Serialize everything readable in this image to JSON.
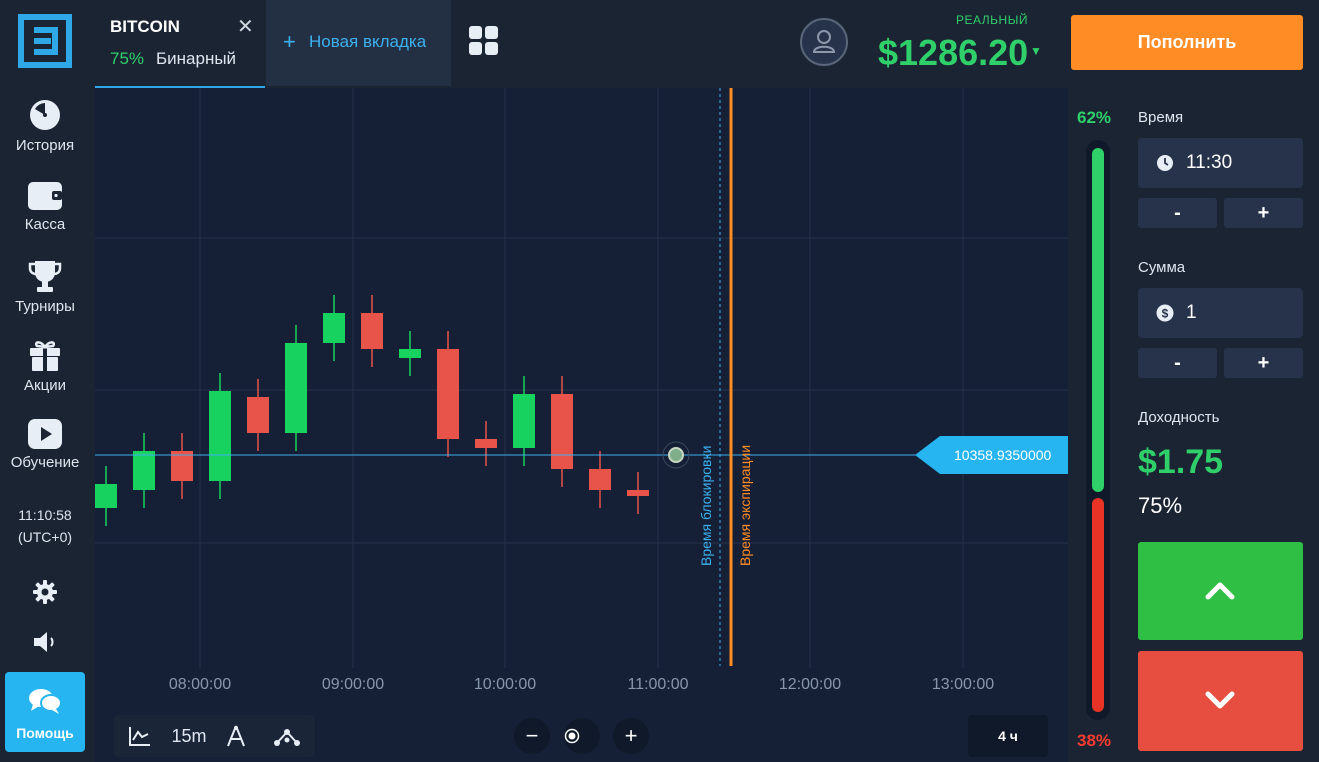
{
  "sidebar": {
    "items": [
      {
        "label": "История",
        "icon": "history-clock-icon"
      },
      {
        "label": "Касса",
        "icon": "wallet-icon"
      },
      {
        "label": "Турниры",
        "icon": "trophy-icon"
      },
      {
        "label": "Акции",
        "icon": "gift-icon"
      },
      {
        "label": "Обучение",
        "icon": "play-icon"
      }
    ],
    "clock_time": "11:10:58",
    "clock_tz": "(UTC+0)",
    "help_label": "Помощь"
  },
  "tabs": {
    "active": {
      "title": "BITCOIN",
      "percent": "75%",
      "type": "Бинарный"
    },
    "new_tab_label": "Новая вкладка"
  },
  "account": {
    "type_label": "РЕАЛЬНЫЙ",
    "balance": "$1286.20",
    "deposit_label": "Пополнить"
  },
  "chart": {
    "current_price": "10358.9350000",
    "lock_line_label": "Время блокировки",
    "expiry_line_label": "Время экспирации",
    "timeframe": "15m",
    "period": "4 ч",
    "zoom_out": "−",
    "zoom_in": "+",
    "colors": {
      "up": "#18d25f",
      "down": "#e8534a",
      "price_line": "#3cb0f0",
      "expiry": "#ff8c24"
    }
  },
  "chart_data": {
    "type": "candlestick",
    "x_ticks": [
      "08:00:00",
      "09:00:00",
      "10:00:00",
      "11:00:00",
      "12:00:00",
      "13:00:00"
    ],
    "candles": [
      {
        "dir": "up",
        "open": 0.0,
        "close": 0.8
      },
      {
        "dir": "up",
        "open": 0.6,
        "close": 1.9
      },
      {
        "dir": "down",
        "open": 1.9,
        "close": 0.9
      },
      {
        "dir": "up",
        "open": 0.9,
        "close": 3.9
      },
      {
        "dir": "down",
        "open": 3.7,
        "close": 2.5
      },
      {
        "dir": "up",
        "open": 2.5,
        "close": 5.5
      },
      {
        "dir": "up",
        "open": 5.5,
        "close": 6.5
      },
      {
        "dir": "down",
        "open": 6.5,
        "close": 5.3
      },
      {
        "dir": "up",
        "open": 5.0,
        "close": 5.3
      },
      {
        "dir": "down",
        "open": 5.3,
        "close": 2.3
      },
      {
        "dir": "down",
        "open": 2.3,
        "close": 2.0
      },
      {
        "dir": "up",
        "open": 2.0,
        "close": 3.8
      },
      {
        "dir": "down",
        "open": 3.8,
        "close": 1.3
      },
      {
        "dir": "down",
        "open": 1.3,
        "close": 0.6
      },
      {
        "dir": "down",
        "open": 0.6,
        "close": 0.4
      }
    ]
  },
  "sentiment": {
    "up": "62%",
    "down": "38%",
    "up_fraction": 0.62
  },
  "panel": {
    "time_label": "Время",
    "time_value": "11:30",
    "amount_label": "Сумма",
    "amount_value": "1",
    "minus": "-",
    "plus": "+",
    "profit_label": "Доходность",
    "profit_amount": "$1.75",
    "profit_percent": "75%"
  }
}
